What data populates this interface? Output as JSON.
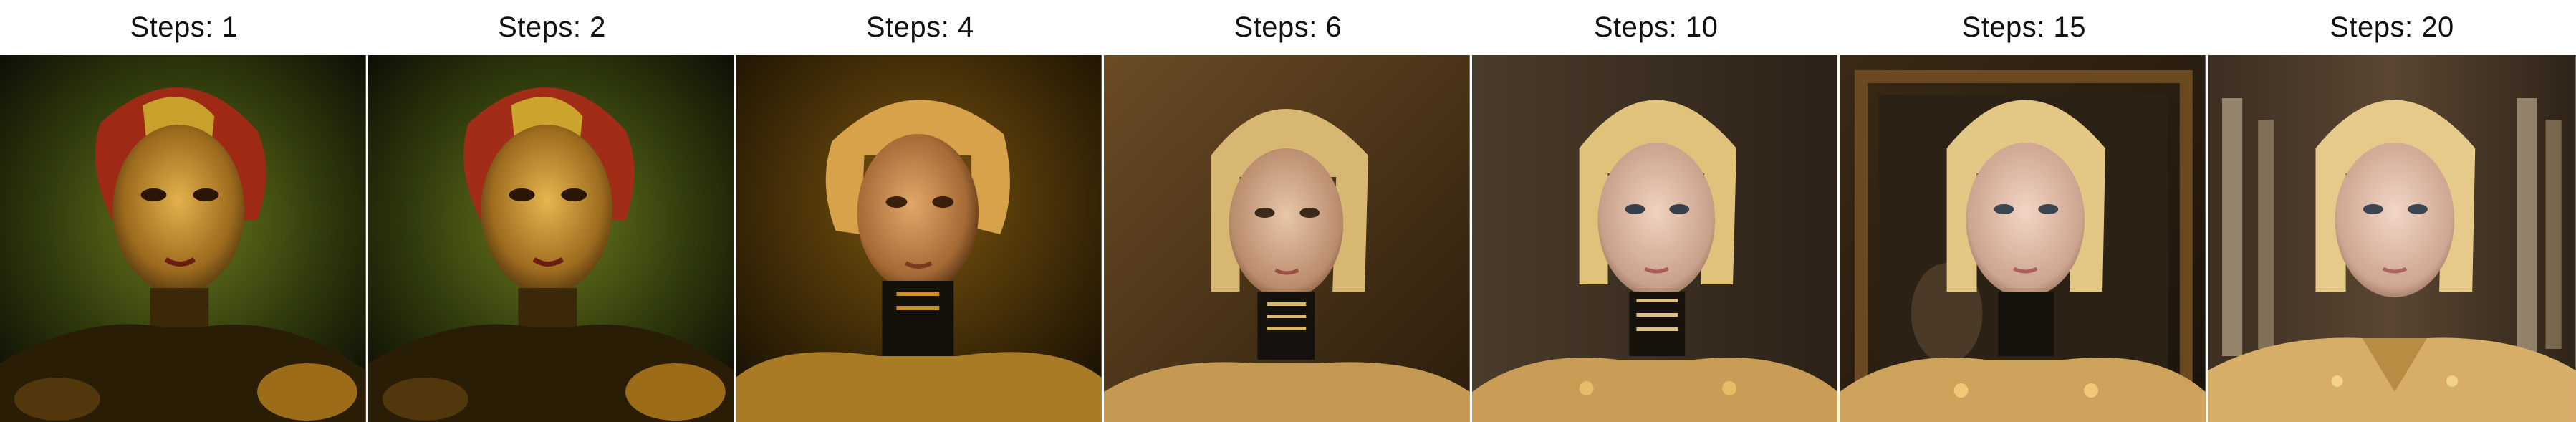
{
  "panels": [
    {
      "label": "Steps: 1",
      "scene": "Noisy painterly portrait with red-tinted hair and greenish background"
    },
    {
      "label": "Steps: 2",
      "scene": "Noisy painterly portrait with red-tinted hair and greenish background"
    },
    {
      "label": "Steps: 4",
      "scene": "Woman with golden bob haircut, black high collar and gold shoulder armor"
    },
    {
      "label": "Steps: 6",
      "scene": "Blonde woman in black and gold robotic armor, brown backdrop"
    },
    {
      "label": "Steps: 10",
      "scene": "Blonde woman with mechanical collar and gold armor plates"
    },
    {
      "label": "Steps: 15",
      "scene": "Blonde woman in front of a framed mirror, mechanical gold armor"
    },
    {
      "label": "Steps: 20",
      "scene": "Blonde woman in a hallway wearing a gold high-collar suit"
    }
  ],
  "colors": {
    "background": "#ffffff",
    "label_text": "#111111"
  }
}
